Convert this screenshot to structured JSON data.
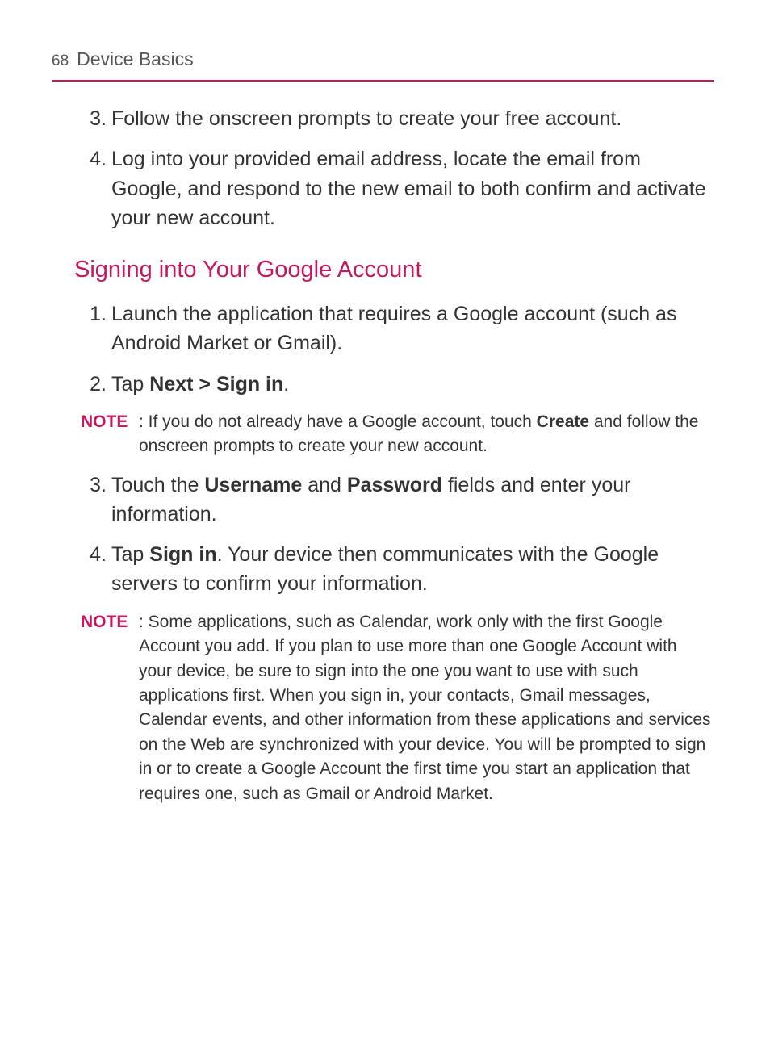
{
  "header": {
    "pageNumber": "68",
    "title": "Device Basics"
  },
  "topList": {
    "item3": {
      "num": "3.",
      "text": "Follow the onscreen prompts to create your free account."
    },
    "item4": {
      "num": "4.",
      "text": "Log into your provided email address, locate the email from Google, and respond to the new email to both confirm and activate your new account."
    }
  },
  "section": {
    "heading": "Signing into Your Google Account",
    "item1": {
      "num": "1.",
      "text": "Launch the application that requires a Google account (such as Android Market or Gmail)."
    },
    "item2": {
      "num": "2.",
      "pre": "Tap ",
      "bold": "Next > Sign in",
      "post": "."
    },
    "note1": {
      "label": "NOTE",
      "pre": ": If you do not already have a Google account, touch ",
      "bold": "Create",
      "post": " and follow the onscreen prompts to create your new account."
    },
    "item3": {
      "num": "3.",
      "pre": "Touch the ",
      "bold1": "Username",
      "mid": " and ",
      "bold2": "Password",
      "post": " fields and enter your information."
    },
    "item4": {
      "num": "4.",
      "pre": "Tap ",
      "bold": "Sign in",
      "post": ". Your device then communicates with the Google servers to confirm your information."
    },
    "note2": {
      "label": "NOTE",
      "text": " : Some applications, such as Calendar, work only with the first Google Account you add. If you plan to use more than one Google Account with your device, be sure to sign into the one you want to use with such applications first. When you sign in, your contacts, Gmail messages, Calendar events, and other information from these applications and services on the Web are synchronized with your device. You will be prompted to sign in or to create a Google Account the first time you start an application that requires one, such as Gmail or Android Market."
    }
  }
}
